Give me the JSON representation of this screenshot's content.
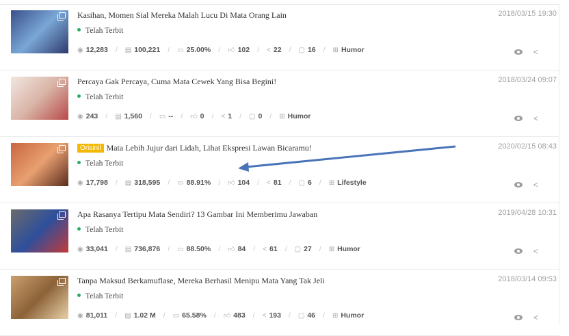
{
  "articles": [
    {
      "title": "Kasihan, Momen Sial Mereka Malah Lucu Di Mata Orang Lain",
      "tag": "",
      "status": "Telah Terbit",
      "date": "2018/03/15 19:30",
      "views": "12,283",
      "reads": "100,221",
      "rate": "25.00%",
      "likes": "102",
      "shares": "22",
      "comments": "16",
      "category": "Humor",
      "thumb_colors": [
        "#3a4f8a",
        "#7aa7d6",
        "#2d3a6b"
      ]
    },
    {
      "title": "Percaya Gak Percaya, Cuma Mata Cewek Yang Bisa Begini!",
      "tag": "",
      "status": "Telah Terbit",
      "date": "2018/03/24 09:07",
      "views": "243",
      "reads": "1,560",
      "rate": "--",
      "likes": "0",
      "shares": "1",
      "comments": "0",
      "category": "Humor",
      "thumb_colors": [
        "#f1e6e1",
        "#d9b4a6",
        "#b84a4a"
      ]
    },
    {
      "title": "Mata Lebih Jujur dari Lidah, Lihat Ekspresi Lawan Bicaramu!",
      "tag": "Orisinil",
      "status": "Telah Terbit",
      "date": "2020/02/15 08:43",
      "views": "17,798",
      "reads": "318,595",
      "rate": "88.91%",
      "likes": "104",
      "shares": "81",
      "comments": "6",
      "category": "Lifestyle",
      "thumb_colors": [
        "#c8663f",
        "#e8a070",
        "#5a2c1e"
      ]
    },
    {
      "title": "Apa Rasanya Tertipu Mata Sendiri? 13 Gambar Ini Memberimu Jawaban",
      "tag": "",
      "status": "Telah Terbit",
      "date": "2019/04/28 10:31",
      "views": "33,041",
      "reads": "736,876",
      "rate": "88.50%",
      "likes": "84",
      "shares": "61",
      "comments": "27",
      "category": "Humor",
      "thumb_colors": [
        "#6b6b6b",
        "#2e4f9c",
        "#c33a3a"
      ]
    },
    {
      "title": "Tanpa Maksud Berkamuflase, Mereka Berhasil Menipu Mata Yang Tak Jeli",
      "tag": "",
      "status": "Telah Terbit",
      "date": "2018/03/14 09:53",
      "views": "81,011",
      "reads": "1.02 M",
      "rate": "65.58%",
      "likes": "483",
      "shares": "193",
      "comments": "46",
      "category": "Humor",
      "thumb_colors": [
        "#caa070",
        "#8c6238",
        "#e8d0a8"
      ]
    }
  ],
  "colors": {
    "status_dot": "#27ae60",
    "tag_bg": "#f5b800",
    "arrow": "#4a74b8"
  },
  "icons": {
    "views": "eye-icon",
    "reads": "document-icon",
    "rate": "progress-icon",
    "likes": "thumbs-up-icon",
    "shares": "share-icon",
    "comments": "comment-icon",
    "category": "grid-icon",
    "preview": "eye-icon",
    "share_action": "share-icon"
  }
}
